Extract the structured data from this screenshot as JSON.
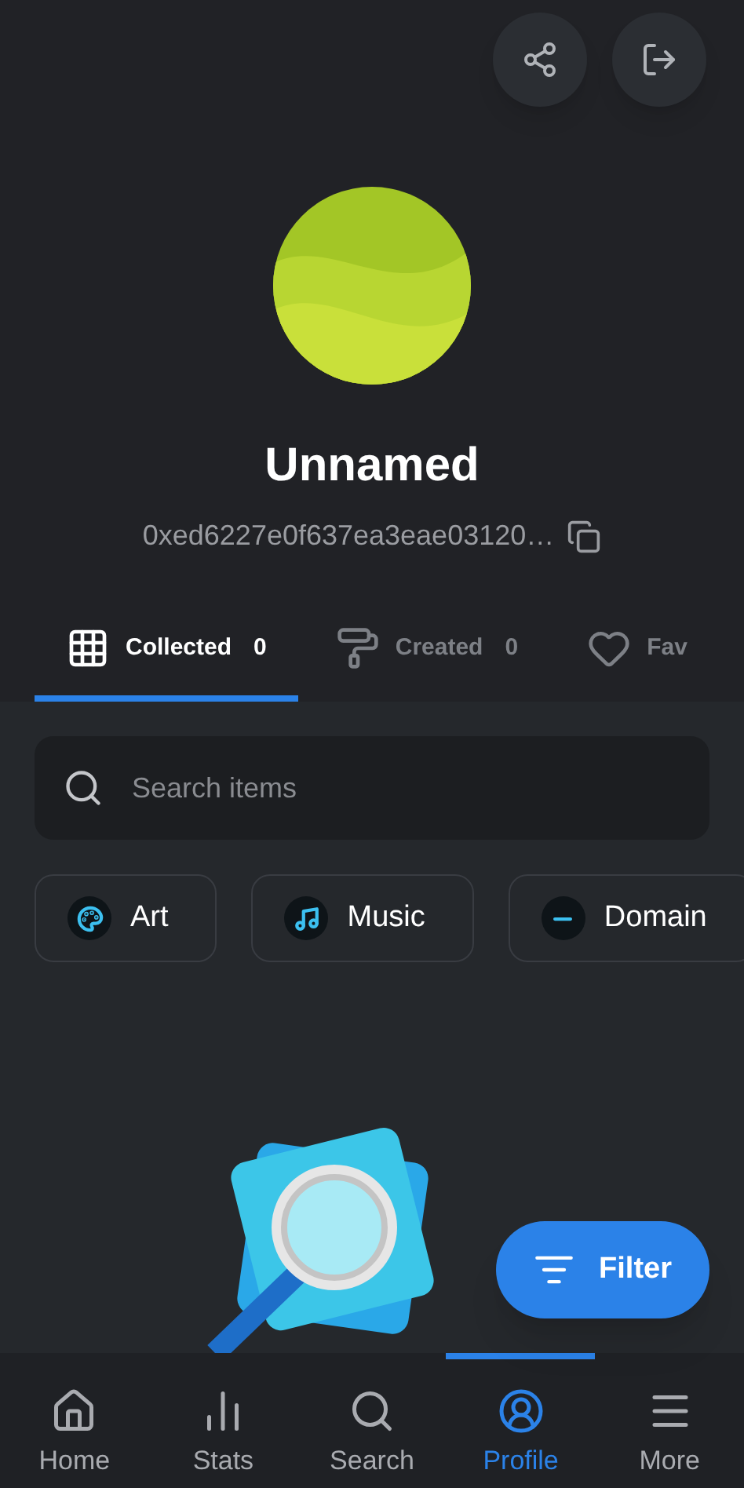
{
  "profile": {
    "name": "Unnamed",
    "address": "0xed6227e0f637ea3eae03120…"
  },
  "tabs": [
    {
      "kind": "grid",
      "label": "Collected",
      "count": "0",
      "selected": true
    },
    {
      "kind": "roller",
      "label": "Created",
      "count": "0",
      "selected": false
    },
    {
      "kind": "heart",
      "label": "Fav",
      "selected": false
    }
  ],
  "search": {
    "placeholder": "Search items"
  },
  "categories": [
    {
      "kind": "art",
      "label": "Art"
    },
    {
      "kind": "music",
      "label": "Music"
    },
    {
      "kind": "domain",
      "label": "Domain"
    }
  ],
  "filter_button": {
    "label": "Filter"
  },
  "nav": [
    {
      "kind": "home",
      "label": "Home",
      "selected": false
    },
    {
      "kind": "stats",
      "label": "Stats",
      "selected": false
    },
    {
      "kind": "search",
      "label": "Search",
      "selected": false
    },
    {
      "kind": "profile",
      "label": "Profile",
      "selected": true
    },
    {
      "kind": "more",
      "label": "More",
      "selected": false
    }
  ]
}
